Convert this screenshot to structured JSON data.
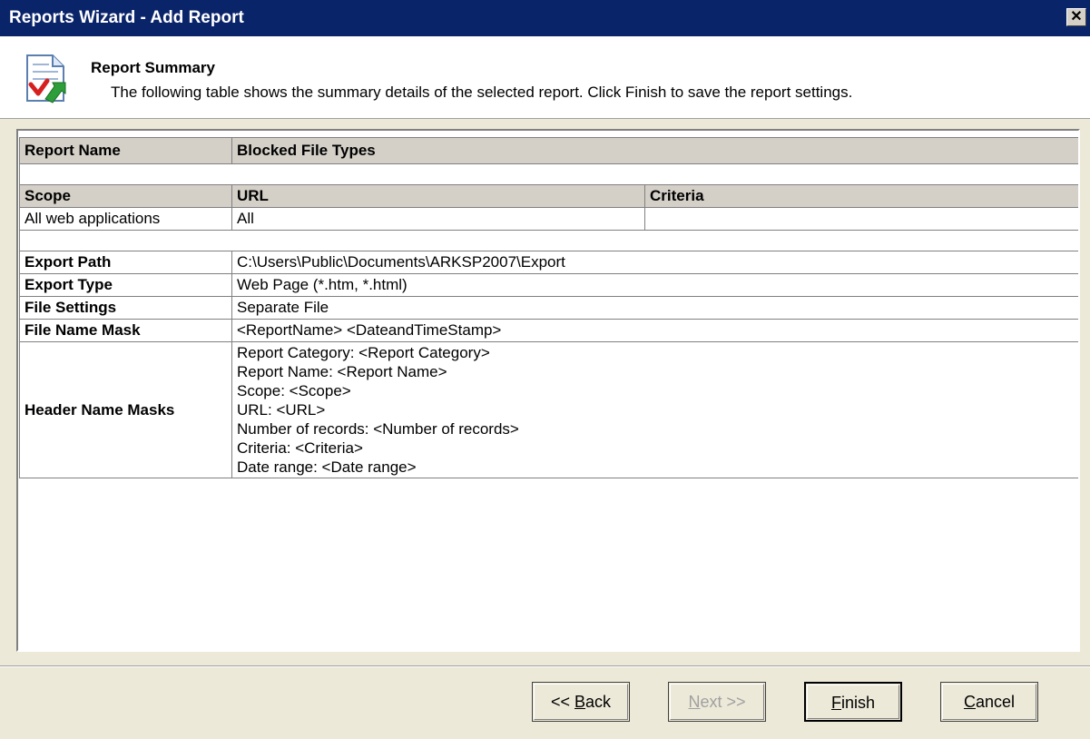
{
  "window": {
    "title": "Reports Wizard - Add Report",
    "close_glyph": "✕",
    "icon": "report-check-icon"
  },
  "header": {
    "title": "Report Summary",
    "subtitle": "The following table shows the summary details of the selected report. Click Finish to save the report settings."
  },
  "summary": {
    "report_name_label": "Report Name",
    "report_name_value": "Blocked File Types",
    "scope_header": "Scope",
    "url_header": "URL",
    "criteria_header": "Criteria",
    "scope_value": "All web applications",
    "url_value": "All",
    "criteria_value": "",
    "export_path_label": "Export Path",
    "export_path_value": "C:\\Users\\Public\\Documents\\ARKSP2007\\Export",
    "export_type_label": "Export Type",
    "export_type_value": "Web Page (*.htm, *.html)",
    "file_settings_label": "File Settings",
    "file_settings_value": "Separate File",
    "file_name_mask_label": "File Name Mask",
    "file_name_mask_value": "<ReportName> <DateandTimeStamp>",
    "header_name_masks_label": "Header Name Masks",
    "header_name_masks": [
      "Report Category: <Report Category>",
      "Report Name: <Report Name>",
      "Scope: <Scope>",
      "URL: <URL>",
      "Number of records: <Number of records>",
      "Criteria: <Criteria>",
      "Date range: <Date range>"
    ]
  },
  "buttons": {
    "back": {
      "pre": "<< ",
      "mnemonic": "B",
      "post": "ack"
    },
    "next": {
      "pre": "",
      "mnemonic": "N",
      "post": "ext >>"
    },
    "finish": {
      "pre": "",
      "mnemonic": "F",
      "post": "inish"
    },
    "cancel": {
      "pre": "",
      "mnemonic": "C",
      "post": "ancel"
    }
  }
}
